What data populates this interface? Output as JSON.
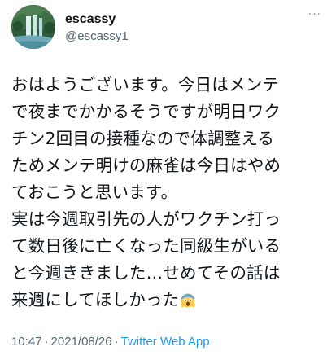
{
  "user": {
    "display_name": "escassy",
    "handle": "@escassy1",
    "avatar_icon": "waterfall-avatar"
  },
  "more_label": "···",
  "body_lines": [
    "おはようございます。今日はメンテ",
    "で夜までかかるそうですが明日ワク",
    "チン2回目の接種なので体調整える",
    "ためメンテ明けの麻雀は今日はやめ",
    "ておこうと思います。",
    "実は今週取引先の人がワクチン打っ",
    "て数日後に亡くなった同級生がいる",
    "と今週ききました…せめてその話は",
    "来週にしてほしかった"
  ],
  "emoji_icon": "face-screaming-in-fear-icon",
  "meta": {
    "time": "10:47",
    "separator": "·",
    "date": "2021/08/26",
    "source": "Twitter Web App"
  }
}
